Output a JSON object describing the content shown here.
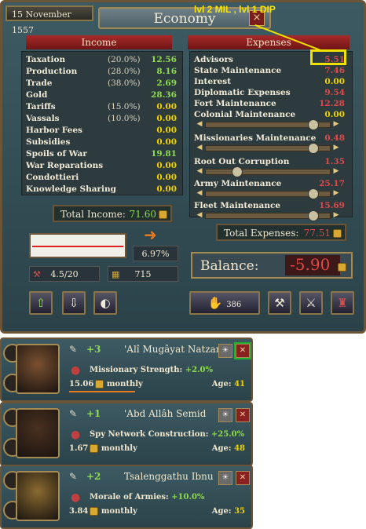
{
  "header": {
    "date": "15 November 1557",
    "title": "Economy",
    "annotation": "lvl 2 MIL , lvl 1 DIP",
    "close_glyph": "×"
  },
  "income": {
    "heading": "Income",
    "rows": [
      {
        "label": "Taxation",
        "pct": "(20.0%)",
        "value": "12.56"
      },
      {
        "label": "Production",
        "pct": "(28.0%)",
        "value": "8.16"
      },
      {
        "label": "Trade",
        "pct": "(38.0%)",
        "value": "2.69"
      },
      {
        "label": "Gold",
        "pct": "",
        "value": "28.36"
      },
      {
        "label": "Tariffs",
        "pct": "(15.0%)",
        "value": "0.00"
      },
      {
        "label": "Vassals",
        "pct": "(10.0%)",
        "value": "0.00"
      },
      {
        "label": "Harbor Fees",
        "pct": "",
        "value": "0.00"
      },
      {
        "label": "Subsidies",
        "pct": "",
        "value": "0.00"
      },
      {
        "label": "Spoils of War",
        "pct": "",
        "value": "19.81"
      },
      {
        "label": "War Reparations",
        "pct": "",
        "value": "0.00"
      },
      {
        "label": "Condottieri",
        "pct": "",
        "value": "0.00"
      },
      {
        "label": "Knowledge Sharing",
        "pct": "",
        "value": "0.00"
      }
    ],
    "total_label": "Total Income:",
    "total_value": "71.60"
  },
  "expenses": {
    "heading": "Expenses",
    "rows": [
      {
        "label": "Advisors",
        "value": "5.51"
      },
      {
        "label": "State Maintenance",
        "value": "7.46"
      },
      {
        "label": "Interest",
        "value": "0.00"
      },
      {
        "label": "Diplomatic Expenses",
        "value": "9.54"
      },
      {
        "label": "Fort Maintenance",
        "value": "12.28"
      },
      {
        "label": "Colonial Maintenance",
        "value": "0.00"
      },
      {
        "label": "Missionaries Maintenance",
        "value": "0.48"
      },
      {
        "label": "Root Out Corruption",
        "value": "1.35"
      },
      {
        "label": "Army Maintenance",
        "value": "25.17"
      },
      {
        "label": "Fleet Maintenance",
        "value": "15.69"
      }
    ],
    "total_label": "Total Expenses:",
    "total_value": "77.51"
  },
  "stats": {
    "inflation": "6.97%",
    "loans": "4.5/20",
    "treasury": "715",
    "gold_button": "386"
  },
  "balance": {
    "label": "Balance:",
    "value": "-5.90"
  },
  "advisors": [
    {
      "skill": "+3",
      "name": "'Alî Mugâyat Natzar",
      "effect_label": "Missionary Strength:",
      "effect_value": "+2.0%",
      "cost": "15.06",
      "period": "monthly",
      "age_label": "Age:",
      "age": "41"
    },
    {
      "skill": "+1",
      "name": "'Abd Allâh Semid",
      "effect_label": "Spy Network Construction:",
      "effect_value": "+25.0%",
      "cost": "1.67",
      "period": "monthly",
      "age_label": "Age:",
      "age": "48"
    },
    {
      "skill": "+2",
      "name": "Tsalenggathu Ibnu",
      "effect_label": "Morale of Armies:",
      "effect_value": "+10.0%",
      "cost": "3.84",
      "period": "monthly",
      "age_label": "Age:",
      "age": "35"
    }
  ],
  "colors": {
    "positive": "#8fdc4a",
    "neutral": "#f0d000",
    "negative": "#e04848",
    "highlight_yellow": "#f0e000",
    "highlight_green": "#20b030"
  }
}
